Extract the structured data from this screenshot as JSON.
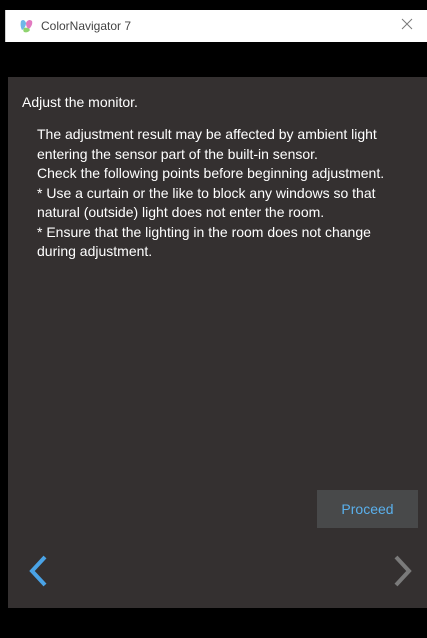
{
  "window": {
    "title": "ColorNavigator 7",
    "icon": "colornavigator-app-icon",
    "close_icon": "close-icon"
  },
  "main": {
    "heading": "Adjust the monitor.",
    "body_lines": [
      "The adjustment result may be affected by ambient light",
      "entering the sensor part of the built-in sensor.",
      "Check the following points before beginning adjustment.",
      "* Use a curtain or the like to block any windows so that",
      "natural (outside) light does not enter the room.",
      "* Ensure that the lighting in the room does not change",
      "during adjustment."
    ],
    "proceed_label": "Proceed"
  },
  "navigation": {
    "back_icon": "chevron-left-icon",
    "forward_icon": "chevron-right-icon"
  },
  "colors": {
    "content_background": "#343030",
    "accent": "#5ab0ec",
    "button_background": "#48494a",
    "disabled": "#7a7a7a"
  }
}
